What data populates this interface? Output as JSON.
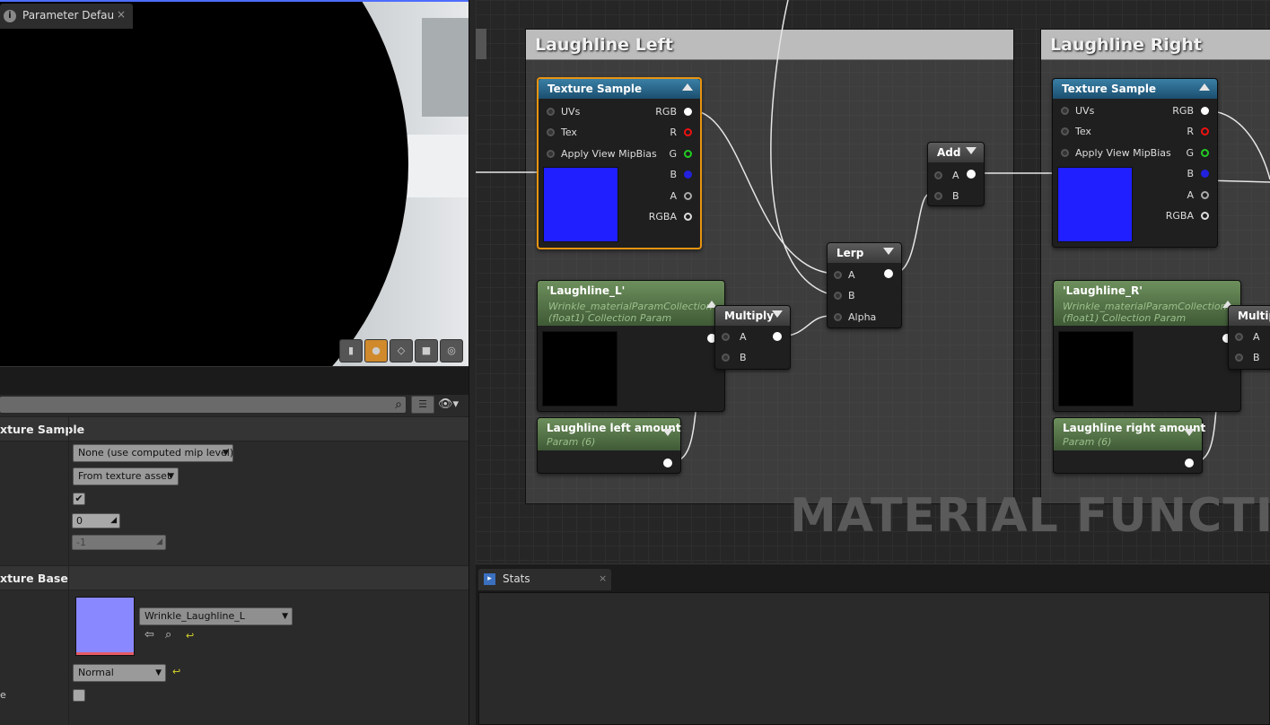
{
  "param_panel": {
    "tab_label": "Parameter Defaults",
    "tab_close": "×",
    "categories": {
      "texture_sample": "xture Sample",
      "texture_base": "xture Base"
    },
    "mip_value_mode": "None (use computed mip level)",
    "sampler_source": "From texture asset",
    "checkbox_checked": "✔",
    "const_coordinate": "0",
    "const_mip": "-1",
    "texture_name": "Wrinkle_Laughline_L",
    "sampler_type": "Normal",
    "truncated_label": "e"
  },
  "graph": {
    "comments": {
      "left": "Laughline Left",
      "right": "Laughline Right"
    },
    "watermark": "MATERIAL FUNCTION",
    "texture_sample_title": "Texture Sample",
    "pins": {
      "uvs": "UVs",
      "tex": "Tex",
      "mipbias": "Apply View MipBias",
      "rgb": "RGB",
      "r": "R",
      "g": "G",
      "b": "B",
      "a": "A",
      "rgba": "RGBA",
      "alpha": "Alpha"
    },
    "add_title": "Add",
    "lerp_title": "Lerp",
    "multiply_title": "Multiply",
    "multiply_title_cut": "Multip",
    "collection_left": "'Laughline_L'",
    "collection_right": "'Laughline_R'",
    "collection_sub1": "Wrinkle_materialParamCollection",
    "collection_sub2": "(float1) Collection Param",
    "param_left": "Laughline left amount",
    "param_right": "Laughline right amount",
    "param_sub": "Param (6)"
  },
  "stats": {
    "tab_label": "Stats",
    "tab_close": "×"
  },
  "colors": {
    "selection": "#e8940f",
    "texture_preview": "#1f1fff",
    "normal_map_thumb": "#8a88ff"
  }
}
